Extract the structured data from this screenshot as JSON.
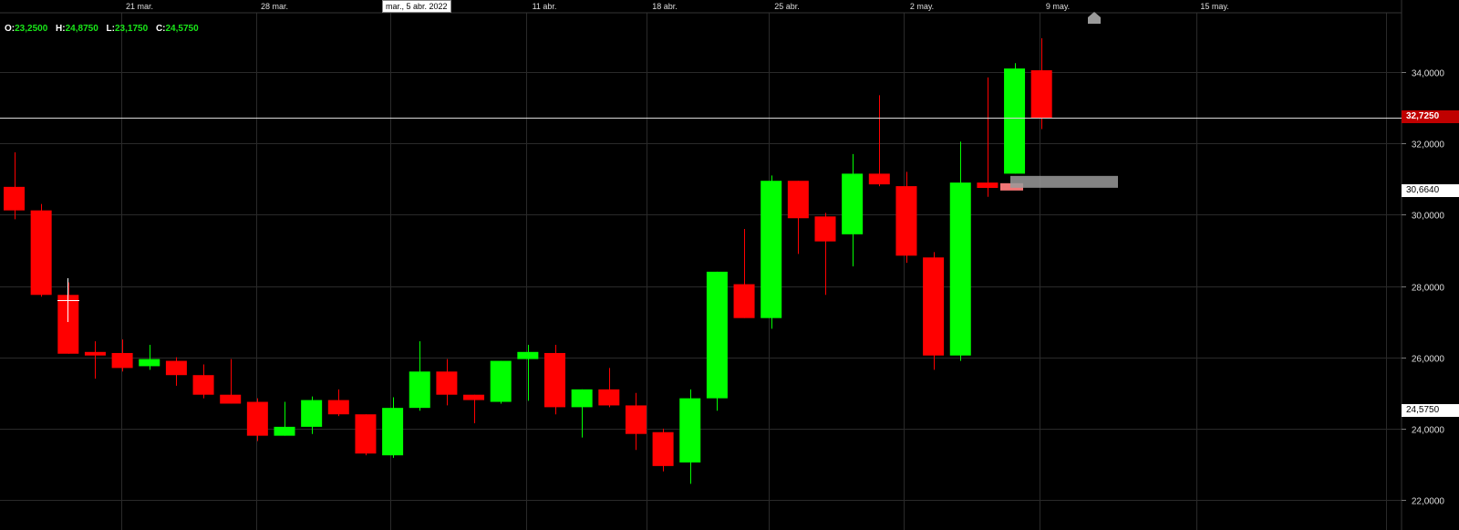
{
  "ohlc_readout": {
    "o_label": "O:",
    "o_value": "23,2500",
    "h_label": "H:",
    "h_value": "24,8750",
    "l_label": "L:",
    "l_value": "23,1750",
    "c_label": "C:",
    "c_value": "24,5750"
  },
  "crosshair_date_label": "mar., 5 abr. 2022",
  "colors": {
    "background": "#000000",
    "up": "#00ff00",
    "down": "#ff0000",
    "grid": "#2a2a2a",
    "price_tag_current": "#cc0000"
  },
  "price_tags": {
    "current": "32,7250",
    "level_a": "30,6640",
    "level_b": "24,5750"
  },
  "chart_data": {
    "type": "candlestick",
    "x_tick_labels": [
      "21 mar.",
      "28 mar.",
      "11 abr.",
      "18 abr.",
      "25 abr.",
      "2 may.",
      "9 may.",
      "15 may."
    ],
    "y_tick_labels": [
      "34,0000",
      "32,0000",
      "30,0000",
      "28,0000",
      "26,0000",
      "24,0000",
      "22,0000"
    ],
    "y_ticks": [
      34,
      32,
      30,
      28,
      26,
      24,
      22
    ],
    "ylim": [
      21.4,
      36.9
    ],
    "current_price": 32.725,
    "grid": true,
    "candles": [
      {
        "o": 30.78,
        "h": 31.75,
        "l": 29.87,
        "c": 30.12
      },
      {
        "o": 30.12,
        "h": 30.3,
        "l": 27.7,
        "c": 27.75
      },
      {
        "o": 27.75,
        "h": 28.1,
        "l": 26.1,
        "c": 26.1
      },
      {
        "o": 26.15,
        "h": 26.45,
        "l": 25.4,
        "c": 26.05
      },
      {
        "o": 26.12,
        "h": 26.5,
        "l": 25.6,
        "c": 25.7
      },
      {
        "o": 25.75,
        "h": 26.35,
        "l": 25.65,
        "c": 25.95
      },
      {
        "o": 25.9,
        "h": 26.0,
        "l": 25.2,
        "c": 25.5
      },
      {
        "o": 25.5,
        "h": 25.8,
        "l": 24.85,
        "c": 24.95
      },
      {
        "o": 24.95,
        "h": 25.95,
        "l": 24.7,
        "c": 24.7
      },
      {
        "o": 24.75,
        "h": 24.85,
        "l": 23.65,
        "c": 23.8
      },
      {
        "o": 23.8,
        "h": 24.75,
        "l": 23.8,
        "c": 24.05
      },
      {
        "o": 24.05,
        "h": 24.9,
        "l": 23.85,
        "c": 24.8
      },
      {
        "o": 24.8,
        "h": 25.1,
        "l": 24.35,
        "c": 24.4
      },
      {
        "o": 24.4,
        "h": 24.4,
        "l": 23.25,
        "c": 23.3
      },
      {
        "o": 23.25,
        "h": 24.88,
        "l": 23.18,
        "c": 24.58
      },
      {
        "o": 24.58,
        "h": 26.45,
        "l": 24.5,
        "c": 25.6
      },
      {
        "o": 25.6,
        "h": 25.95,
        "l": 24.65,
        "c": 24.95
      },
      {
        "o": 24.95,
        "h": 24.95,
        "l": 24.15,
        "c": 24.8
      },
      {
        "o": 24.75,
        "h": 25.9,
        "l": 24.7,
        "c": 25.9
      },
      {
        "o": 25.95,
        "h": 26.35,
        "l": 24.78,
        "c": 26.15
      },
      {
        "o": 26.12,
        "h": 26.35,
        "l": 24.4,
        "c": 24.6
      },
      {
        "o": 24.6,
        "h": 25.1,
        "l": 23.75,
        "c": 25.1
      },
      {
        "o": 25.1,
        "h": 25.7,
        "l": 24.6,
        "c": 24.65
      },
      {
        "o": 24.65,
        "h": 25.0,
        "l": 23.4,
        "c": 23.85
      },
      {
        "o": 23.9,
        "h": 24.0,
        "l": 22.8,
        "c": 22.95
      },
      {
        "o": 23.05,
        "h": 25.1,
        "l": 22.45,
        "c": 24.85
      },
      {
        "o": 24.85,
        "h": 28.4,
        "l": 24.5,
        "c": 28.4
      },
      {
        "o": 28.05,
        "h": 29.6,
        "l": 27.1,
        "c": 27.1
      },
      {
        "o": 27.1,
        "h": 31.1,
        "l": 26.8,
        "c": 30.95
      },
      {
        "o": 30.95,
        "h": 30.95,
        "l": 28.9,
        "c": 29.9
      },
      {
        "o": 29.95,
        "h": 30.05,
        "l": 27.75,
        "c": 29.25
      },
      {
        "o": 29.45,
        "h": 31.7,
        "l": 28.55,
        "c": 31.15
      },
      {
        "o": 31.15,
        "h": 33.35,
        "l": 30.8,
        "c": 30.85
      },
      {
        "o": 30.8,
        "h": 31.2,
        "l": 28.65,
        "c": 28.85
      },
      {
        "o": 28.8,
        "h": 28.95,
        "l": 25.65,
        "c": 26.05
      },
      {
        "o": 26.05,
        "h": 32.05,
        "l": 25.9,
        "c": 30.9
      },
      {
        "o": 30.9,
        "h": 33.85,
        "l": 30.5,
        "c": 30.75
      },
      {
        "o": 31.15,
        "h": 34.25,
        "l": 31.15,
        "c": 34.1
      },
      {
        "o": 34.05,
        "h": 34.95,
        "l": 32.4,
        "c": 32.72
      }
    ]
  }
}
